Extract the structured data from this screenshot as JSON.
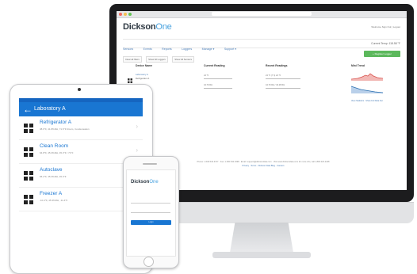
{
  "imac": {
    "browser_url": "",
    "logo_main": "Dickson",
    "logo_accent": "One",
    "top_right": "Welcome  Sign Out | Logout",
    "nav": [
      "Sensors",
      "Events",
      "Reports",
      "Loggers",
      "Manage ▾",
      "Support ▾"
    ],
    "current_temp": "Current Temp: 118.58 °F",
    "filters": [
      "Clear all filters",
      "Show All Loggers",
      "Show All Sensors"
    ],
    "add_button": "+ Register Logger",
    "columns": [
      "Device Name",
      "Current Reading",
      "Recent Readings",
      "Mini Trend"
    ],
    "row_device": "Laboratory A",
    "row_sub": "Refrigerator A",
    "current_field": "24 °F",
    "current_value": "44.79 RH",
    "recent_field": "24 °F (7 h) 24 °F",
    "recent_value": "44.79 RH / 43.28 RH",
    "trend_link": "View Statistics · Show Full Data Set",
    "footer_line1": "Phone: 1.630.543.3747  ·  Fax: 1.630.543.0498  ·  Email: support@dicksondata.com  ·  Visit www.dicksondata.com for more info, call 1.800.323.2448",
    "footer_line2": "Privacy  ·  Terms  ·  Dickson Data Blog  ·  Careers"
  },
  "ipad": {
    "header_title": "Laboratory A",
    "back_icon": "arrow-left-icon",
    "items": [
      {
        "name": "Refrigerator A",
        "sub": "38.6°F, 41.8%RH, 71.6°F Room, Condensation"
      },
      {
        "name": "Clean Room",
        "sub": "64.8°F, 45.3%RH, 45.3°F / 71°F"
      },
      {
        "name": "Autoclave",
        "sub": "65.2°F, 45.3%RH, 45.3°F"
      },
      {
        "name": "Freezer A",
        "sub": "-10.4°F, 45.3%RH, -11.4°F"
      }
    ],
    "grid_icon": "grid-icon",
    "chevron_icon": "chevron-right-icon"
  },
  "iphone": {
    "logo_main": "Dickson",
    "logo_accent": "One",
    "button_label": "Login"
  },
  "colors": {
    "accent": "#1976d2",
    "logo_dark": "#2f3a44",
    "logo_light": "#4aa3df",
    "green": "#5cb85c",
    "chart_red": "#d9534f",
    "chart_blue": "#2a6fb0"
  }
}
